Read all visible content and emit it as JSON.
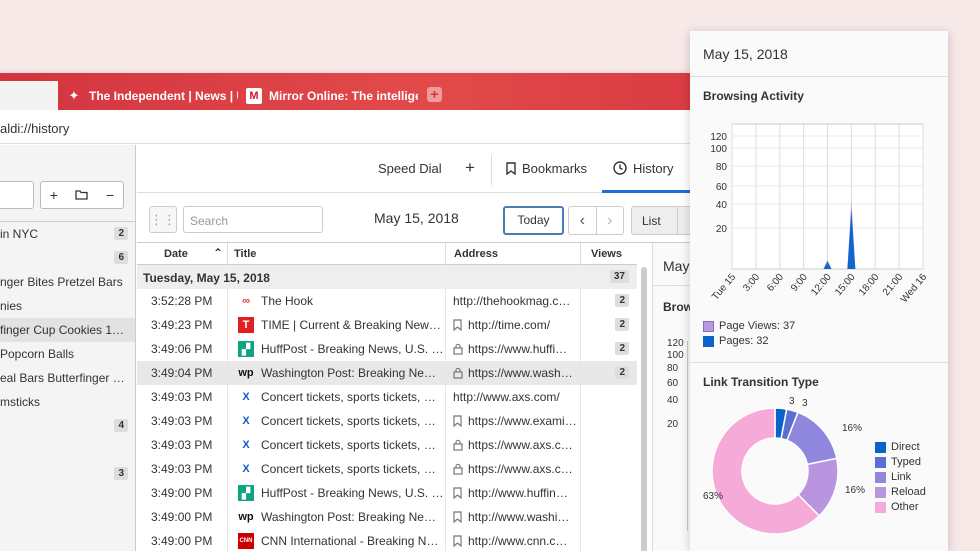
{
  "tabs": [
    {
      "label": "The Independent | News | UK"
    },
    {
      "label": "Mirror Online: The intelligent"
    }
  ],
  "address": "aldi://history",
  "panel": {
    "rows": [
      {
        "label": "in NYC",
        "count": "2"
      },
      {
        "label": "",
        "count": "6"
      },
      {
        "label": "nger Bites Pretzel Bars",
        "count": ""
      },
      {
        "label": "nies",
        "count": ""
      },
      {
        "label": "finger Cup Cookies 1…",
        "count": ""
      },
      {
        "label": "Popcorn Balls",
        "count": ""
      },
      {
        "label": "eal Bars Butterfinger …",
        "count": ""
      },
      {
        "label": "msticks",
        "count": ""
      },
      {
        "label": "",
        "count": "4"
      },
      {
        "label": "",
        "count": ""
      },
      {
        "label": "",
        "count": "3"
      }
    ]
  },
  "nav": {
    "speed_dial": "Speed Dial",
    "plus": "+",
    "bookmarks": "Bookmarks",
    "history": "History"
  },
  "toolbar": {
    "search_placeholder": "Search",
    "date": "May 15, 2018",
    "today": "Today",
    "list": "List"
  },
  "columns": {
    "date": "Date",
    "title": "Title",
    "address": "Address",
    "views": "Views"
  },
  "group": {
    "label": "Tuesday, May 15, 2018",
    "count": "37"
  },
  "rows": [
    {
      "time": "3:52:28 PM",
      "icon": "hook-icon",
      "title": "The Hook",
      "lock": false,
      "bookmark": false,
      "address": "http://thehookmag.c…",
      "views": "2"
    },
    {
      "time": "3:49:23 PM",
      "icon": "time-icon",
      "title": "TIME | Current & Breaking New…",
      "lock": false,
      "bookmark": true,
      "address": "http://time.com/",
      "views": "2"
    },
    {
      "time": "3:49:06 PM",
      "icon": "huffpost-icon",
      "title": "HuffPost - Breaking News, U.S. …",
      "lock": true,
      "bookmark": false,
      "address": "https://www.huffi…",
      "views": "2"
    },
    {
      "time": "3:49:04 PM",
      "icon": "wapo-icon",
      "title": "Washington Post: Breaking Ne…",
      "lock": true,
      "bookmark": false,
      "address": "https://www.wash…",
      "views": "2"
    },
    {
      "time": "3:49:03 PM",
      "icon": "axs-icon",
      "title": "Concert tickets, sports tickets, …",
      "lock": false,
      "bookmark": false,
      "address": "http://www.axs.com/",
      "views": ""
    },
    {
      "time": "3:49:03 PM",
      "icon": "axs-icon",
      "title": "Concert tickets, sports tickets, …",
      "lock": false,
      "bookmark": true,
      "address": "https://www.exami…",
      "views": ""
    },
    {
      "time": "3:49:03 PM",
      "icon": "axs-icon",
      "title": "Concert tickets, sports tickets, …",
      "lock": true,
      "bookmark": false,
      "address": "https://www.axs.c…",
      "views": ""
    },
    {
      "time": "3:49:03 PM",
      "icon": "axs-icon",
      "title": "Concert tickets, sports tickets, …",
      "lock": true,
      "bookmark": false,
      "address": "https://www.axs.c…",
      "views": ""
    },
    {
      "time": "3:49:00 PM",
      "icon": "huffpost-icon",
      "title": "HuffPost - Breaking News, U.S. …",
      "lock": false,
      "bookmark": true,
      "address": "http://www.huffin…",
      "views": ""
    },
    {
      "time": "3:49:00 PM",
      "icon": "wapo-icon",
      "title": "Washington Post: Breaking Ne…",
      "lock": false,
      "bookmark": true,
      "address": "http://www.washi…",
      "views": ""
    },
    {
      "time": "3:49:00 PM",
      "icon": "cnn-icon",
      "title": "CNN International - Breaking N…",
      "lock": false,
      "bookmark": true,
      "address": "http://www.cnn.c…",
      "views": ""
    }
  ],
  "right_pane": {
    "date": "May",
    "section": "Brows",
    "yticks": [
      "120",
      "100",
      "80",
      "60",
      "40",
      "20"
    ]
  },
  "popup": {
    "date": "May 15, 2018",
    "browsing_title": "Browsing Activity",
    "link_title": "Link Transition Type",
    "legend_views": "Page Views: 37",
    "legend_pages": "Pages: 32",
    "colors": {
      "views": "#b99ae0",
      "pages": "#0a63c9"
    }
  },
  "chart_data": [
    {
      "type": "area",
      "title": "Browsing Activity",
      "categories": [
        "Tue 15",
        "3:00",
        "6:00",
        "9:00",
        "12:00",
        "15:00",
        "18:00",
        "21:00",
        "Wed 16"
      ],
      "yticks": [
        "120",
        "100",
        "80",
        "60",
        "40",
        "20"
      ],
      "series": [
        {
          "name": "Page Views: 37",
          "points": [
            [
              11.5,
              0
            ],
            [
              12,
              5
            ],
            [
              12.5,
              0
            ],
            [
              14.5,
              0
            ],
            [
              15,
              37
            ],
            [
              15.5,
              0
            ]
          ]
        },
        {
          "name": "Pages: 32",
          "points": [
            [
              11.5,
              0
            ],
            [
              12,
              4
            ],
            [
              12.5,
              0
            ],
            [
              14.5,
              0
            ],
            [
              15,
              32
            ],
            [
              15.5,
              0
            ]
          ]
        }
      ]
    },
    {
      "type": "pie",
      "title": "Link Transition Type",
      "labels": [
        "Direct",
        "Typed",
        "Link",
        "Reload",
        "Other"
      ],
      "values": [
        3,
        3,
        16,
        16,
        63
      ],
      "value_labels": [
        "3",
        "3",
        "16%",
        "16%",
        "63%"
      ],
      "colors": [
        "#0a63c9",
        "#5a6fd0",
        "#8f86dd",
        "#b995e0",
        "#f5aad7"
      ]
    }
  ]
}
